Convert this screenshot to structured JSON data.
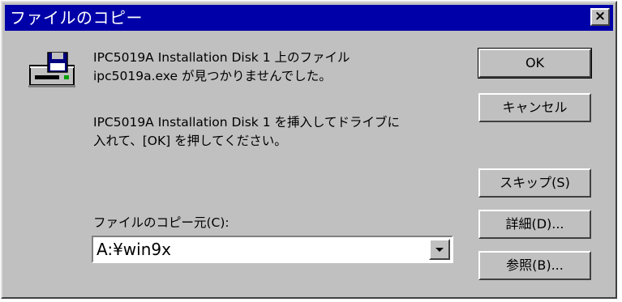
{
  "window": {
    "title": "ファイルのコピー",
    "close_symbol": "×"
  },
  "icon": {
    "name": "floppy-drive-icon"
  },
  "messages": {
    "line1": "IPC5019A Installation Disk 1 上のファイル",
    "line2": "ipc5019a.exe が見つかりませんでした。",
    "line3": "IPC5019A Installation Disk 1 を挿入してドライブに",
    "line4": "入れて、[OK] を押してください。"
  },
  "copy_from": {
    "label": "ファイルのコピー元(C):",
    "value": "A:¥win9x"
  },
  "buttons": {
    "ok": "OK",
    "cancel": "キャンセル",
    "skip": "スキップ(S)",
    "details": "詳細(D)...",
    "browse": "参照(B)..."
  },
  "colors": {
    "titlebar": "#0000a8",
    "face": "#c0c0c0"
  }
}
